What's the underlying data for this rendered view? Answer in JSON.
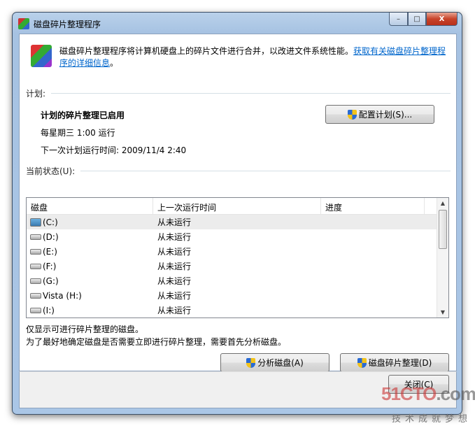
{
  "window": {
    "title": "磁盘碎片整理程序",
    "minimize": "–",
    "maximize": "□",
    "close": "X"
  },
  "intro": {
    "text": "磁盘碎片整理程序将计算机硬盘上的碎片文件进行合并，以改进文件系统性能。",
    "link": "获取有关磁盘碎片整理程序的详细信息",
    "end": "。"
  },
  "schedule": {
    "label": "计划:",
    "status": "计划的碎片整理已启用",
    "frequency": "每星期三  1:00 运行",
    "next_run": "下一次计划运行时间: 2009/11/4 2:40",
    "configure_button": "配置计划(S)..."
  },
  "current": {
    "label": "当前状态(U):",
    "columns": [
      "磁盘",
      "上一次运行时间",
      "进度"
    ],
    "rows": [
      {
        "disk": "(C:)",
        "last": "从未运行",
        "progress": ""
      },
      {
        "disk": "(D:)",
        "last": "从未运行",
        "progress": ""
      },
      {
        "disk": "(E:)",
        "last": "从未运行",
        "progress": ""
      },
      {
        "disk": "(F:)",
        "last": "从未运行",
        "progress": ""
      },
      {
        "disk": "(G:)",
        "last": "从未运行",
        "progress": ""
      },
      {
        "disk": "Vista (H:)",
        "last": "从未运行",
        "progress": ""
      },
      {
        "disk": "(I:)",
        "last": "从未运行",
        "progress": ""
      }
    ]
  },
  "notes": [
    "仅显示可进行碎片整理的磁盘。",
    "为了最好地确定磁盘是否需要立即进行碎片整理，需要首先分析磁盘。"
  ],
  "buttons": {
    "analyze": "分析磁盘(A)",
    "defrag": "磁盘碎片整理(D)",
    "close": "关闭(C)"
  },
  "watermark": {
    "brand": "51CTO.com",
    "slogan": "技术成就梦想"
  }
}
